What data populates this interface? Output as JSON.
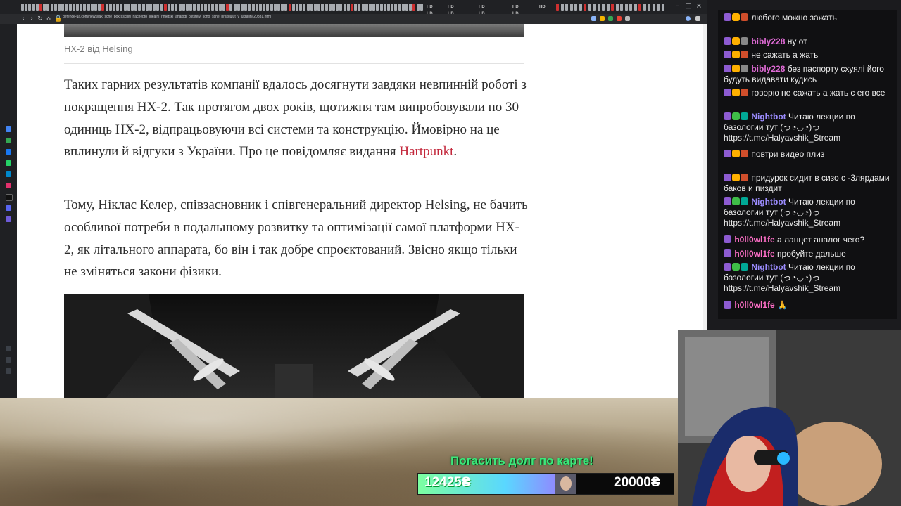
{
  "browser": {
    "url": "defence-ua.com/news/jak_sche_pokraschiti_nachebto_idealni_rimetski_analogi_bststeiv_scho_sche_pratsjujut_v_ukrajini-20831.html",
    "tab_labels": [
      "HD HD",
      "HD HD",
      "HD HD HD",
      "HD HD",
      "HD"
    ],
    "window_controls": [
      "minimize",
      "maximize",
      "close"
    ]
  },
  "article": {
    "caption": "HX-2 від Helsing",
    "paragraph1": "Таких гарних результатів компанії вдалось досягнути завдяки невпинній роботі з покращення HX-2. Так протягом двох років, щотижня там випробовували по 30 одиниць HX-2, відпрацьовуючи всі системи та конструкцію. Ймовірно на це вплинули й відгуки з України. Про це повідомляє видання ",
    "link_text": "Hartpunkt",
    "paragraph1_end": ".",
    "paragraph2": "Тому, Ніклас Келер, співзасновник і співгенеральний директор Helsing, не бачить особливої потреби в подальшому розвитку та оптимізації самої платформи HX-2, як літального аппарата, бо він і так добре спроєктований. Звісно якщо тільки не зміняться закони фізики.",
    "colors": {
      "link": "#c3283c",
      "text": "#2b2b2b",
      "caption": "#7b7b7b"
    }
  },
  "chat": {
    "messages": [
      {
        "user": "",
        "text": "любого можно зажать",
        "user_color": "#2f3fd8"
      },
      {
        "user": "bibly228",
        "text": "ну от",
        "user_color": "#e06bd6"
      },
      {
        "user": "",
        "text": "не сажать а жать",
        "user_color": "#2f3fd8"
      },
      {
        "user": "bibly228",
        "text": "без паспорту схуялі його будуть видавати кудись",
        "user_color": "#e06bd6"
      },
      {
        "user": "",
        "text": "говорю не сажать а жать с его все",
        "user_color": "#2f3fd8"
      },
      {
        "user": "Nightbot",
        "text": "Читаю лекции по базологии тут (っ◔◡◔)っ https://t.me/Halyavshik_Stream",
        "user_color": "#9c8cff"
      },
      {
        "user": "",
        "text": "повтри видео плиз",
        "user_color": "#2f3fd8"
      },
      {
        "user": "",
        "text": "придурок сидит в сизо с -3лярдами баков и пиздит",
        "user_color": "#2f3fd8"
      },
      {
        "user": "Nightbot",
        "text": "Читаю лекции по базологии тут (っ◔◡◔)っ https://t.me/Halyavshik_Stream",
        "user_color": "#9c8cff"
      },
      {
        "user": "h0ll0wl1fe",
        "text": "а ланцет аналог чего?",
        "user_color": "#ff6fc8"
      },
      {
        "user": "h0ll0wl1fe",
        "text": "пробуйте дальше",
        "user_color": "#ff6fc8"
      },
      {
        "user": "Nightbot",
        "text": "Читаю лекции по базологии тут (っ◔◡◔)っ https://t.me/Halyavshik_Stream",
        "user_color": "#9c8cff"
      },
      {
        "user": "h0ll0wl1fe",
        "text": "🙏",
        "user_color": "#ff6fc8"
      }
    ]
  },
  "donation_goal": {
    "title": "Погасить долг по карте!",
    "current": "12425₴",
    "target": "20000₴",
    "progress_fraction": 0.621,
    "color": "#3ce87a"
  }
}
